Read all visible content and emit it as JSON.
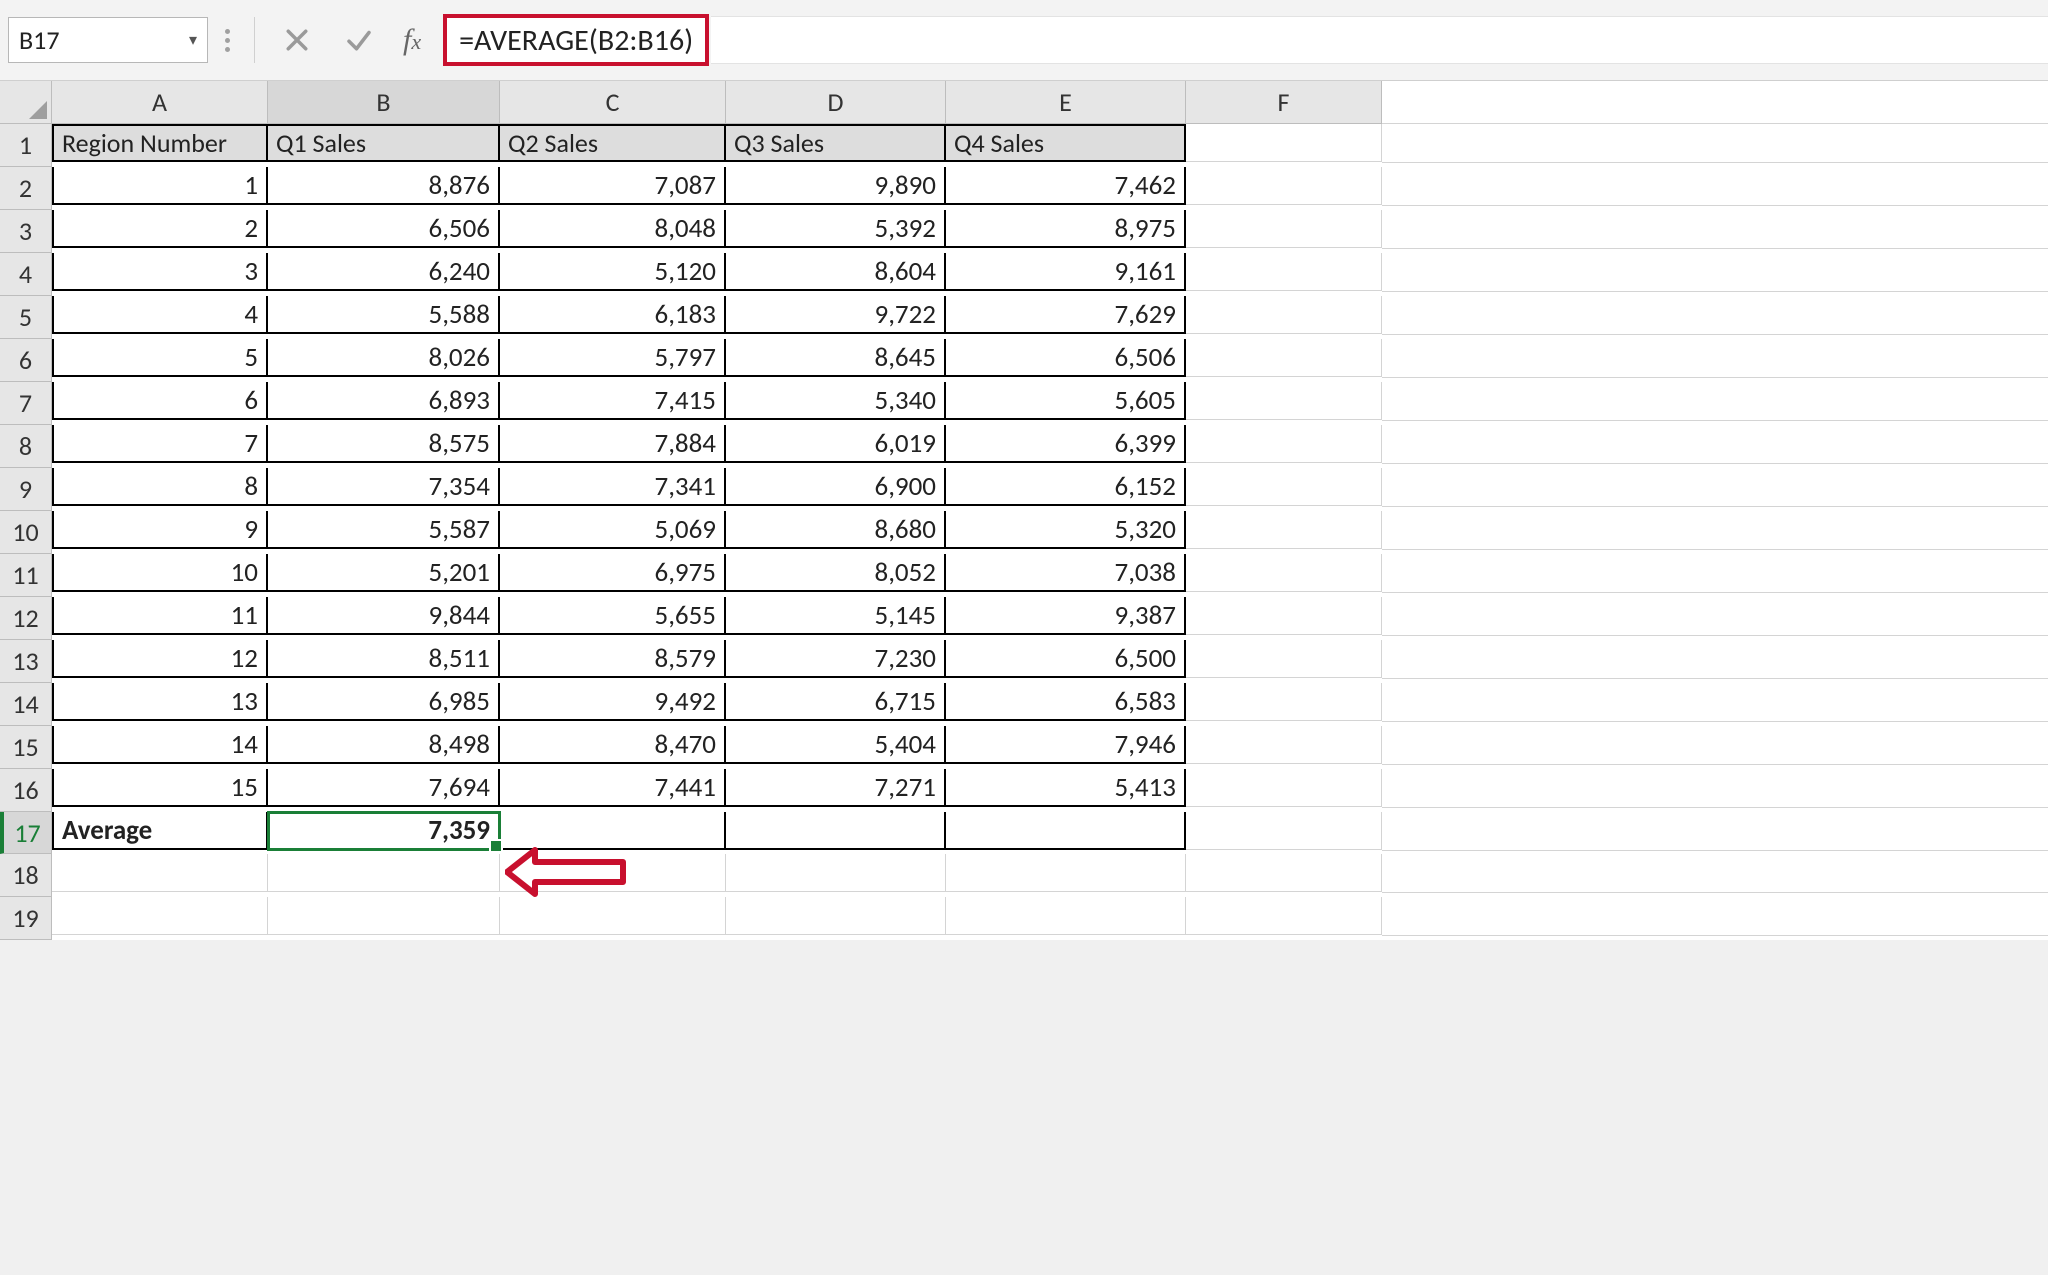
{
  "namebox": {
    "ref": "B17"
  },
  "formula_bar": {
    "formula": "=AVERAGE(B2:B16)"
  },
  "columns": [
    "A",
    "B",
    "C",
    "D",
    "E",
    "F"
  ],
  "row_numbers": [
    1,
    2,
    3,
    4,
    5,
    6,
    7,
    8,
    9,
    10,
    11,
    12,
    13,
    14,
    15,
    16,
    17,
    18,
    19
  ],
  "table": {
    "headers": [
      "Region Number",
      "Q1 Sales",
      "Q2 Sales",
      "Q3 Sales",
      "Q4 Sales"
    ],
    "rows": [
      {
        "region": "1",
        "q1": "8,876",
        "q2": "7,087",
        "q3": "9,890",
        "q4": "7,462"
      },
      {
        "region": "2",
        "q1": "6,506",
        "q2": "8,048",
        "q3": "5,392",
        "q4": "8,975"
      },
      {
        "region": "3",
        "q1": "6,240",
        "q2": "5,120",
        "q3": "8,604",
        "q4": "9,161"
      },
      {
        "region": "4",
        "q1": "5,588",
        "q2": "6,183",
        "q3": "9,722",
        "q4": "7,629"
      },
      {
        "region": "5",
        "q1": "8,026",
        "q2": "5,797",
        "q3": "8,645",
        "q4": "6,506"
      },
      {
        "region": "6",
        "q1": "6,893",
        "q2": "7,415",
        "q3": "5,340",
        "q4": "5,605"
      },
      {
        "region": "7",
        "q1": "8,575",
        "q2": "7,884",
        "q3": "6,019",
        "q4": "6,399"
      },
      {
        "region": "8",
        "q1": "7,354",
        "q2": "7,341",
        "q3": "6,900",
        "q4": "6,152"
      },
      {
        "region": "9",
        "q1": "5,587",
        "q2": "5,069",
        "q3": "8,680",
        "q4": "5,320"
      },
      {
        "region": "10",
        "q1": "5,201",
        "q2": "6,975",
        "q3": "8,052",
        "q4": "7,038"
      },
      {
        "region": "11",
        "q1": "9,844",
        "q2": "5,655",
        "q3": "5,145",
        "q4": "9,387"
      },
      {
        "region": "12",
        "q1": "8,511",
        "q2": "8,579",
        "q3": "7,230",
        "q4": "6,500"
      },
      {
        "region": "13",
        "q1": "6,985",
        "q2": "9,492",
        "q3": "6,715",
        "q4": "6,583"
      },
      {
        "region": "14",
        "q1": "8,498",
        "q2": "8,470",
        "q3": "5,404",
        "q4": "7,946"
      },
      {
        "region": "15",
        "q1": "7,694",
        "q2": "7,441",
        "q3": "7,271",
        "q4": "5,413"
      }
    ],
    "summary": {
      "label": "Average",
      "q1": "7,359",
      "q2": "",
      "q3": "",
      "q4": ""
    }
  },
  "selection": {
    "cell": "B17",
    "row": 17,
    "col": "B"
  },
  "annotations": {
    "formula_box": "highlight",
    "arrow_target": "B17"
  },
  "chart_data": {
    "type": "table",
    "columns": [
      "Region Number",
      "Q1 Sales",
      "Q2 Sales",
      "Q3 Sales",
      "Q4 Sales"
    ],
    "rows": [
      [
        1,
        8876,
        7087,
        9890,
        7462
      ],
      [
        2,
        6506,
        8048,
        5392,
        8975
      ],
      [
        3,
        6240,
        5120,
        8604,
        9161
      ],
      [
        4,
        5588,
        6183,
        9722,
        7629
      ],
      [
        5,
        8026,
        5797,
        8645,
        6506
      ],
      [
        6,
        6893,
        7415,
        5340,
        5605
      ],
      [
        7,
        8575,
        7884,
        6019,
        6399
      ],
      [
        8,
        7354,
        7341,
        6900,
        6152
      ],
      [
        9,
        5587,
        5069,
        8680,
        5320
      ],
      [
        10,
        5201,
        6975,
        8052,
        7038
      ],
      [
        11,
        9844,
        5655,
        5145,
        9387
      ],
      [
        12,
        8511,
        8579,
        7230,
        6500
      ],
      [
        13,
        6985,
        9492,
        6715,
        6583
      ],
      [
        14,
        8498,
        8470,
        5404,
        7946
      ],
      [
        15,
        7694,
        7441,
        7271,
        5413
      ]
    ],
    "summary": {
      "label": "Average",
      "Q1 Sales": 7359
    }
  }
}
